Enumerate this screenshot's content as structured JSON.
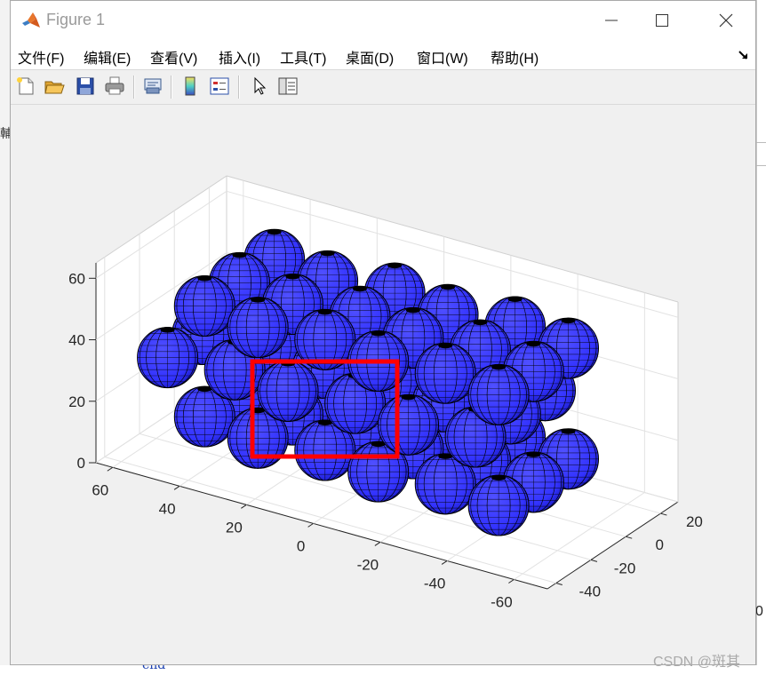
{
  "background": {
    "left_fragment": "輔",
    "code_fragment": "end",
    "right_fragment": "0"
  },
  "window": {
    "title": "Figure 1",
    "controls": {
      "minimize": "minimize",
      "maximize": "maximize",
      "close": "close"
    }
  },
  "menu": {
    "items": [
      "文件(F)",
      "编辑(E)",
      "查看(V)",
      "插入(I)",
      "工具(T)",
      "桌面(D)",
      "窗口(W)",
      "帮助(H)"
    ]
  },
  "toolbar": {
    "buttons": [
      "new-figure-icon",
      "open-file-icon",
      "save-icon",
      "print-icon",
      "link-plot-icon",
      "colorbar-icon",
      "legend-icon",
      "edit-plot-arrow-icon",
      "property-inspector-icon"
    ]
  },
  "chart_data": {
    "type": "3d-surface-spheres",
    "title": "",
    "xlabel": "",
    "ylabel": "",
    "zlabel": "",
    "x_ticks": [
      "60",
      "40",
      "20",
      "0",
      "-20",
      "-40",
      "-60"
    ],
    "y_ticks": [
      "-40",
      "-20",
      "0",
      "20"
    ],
    "z_ticks": [
      "0",
      "20",
      "40",
      "60"
    ],
    "xlim": [
      -70,
      65
    ],
    "ylim": [
      -45,
      30
    ],
    "zlim": [
      0,
      65
    ],
    "grid": true,
    "sphere_face_color": "#3333ff",
    "sphere_edge_color": "#000000",
    "annotation": {
      "type": "rectangle",
      "color": "#ff0000"
    }
  },
  "watermark": "CSDN @斑其"
}
